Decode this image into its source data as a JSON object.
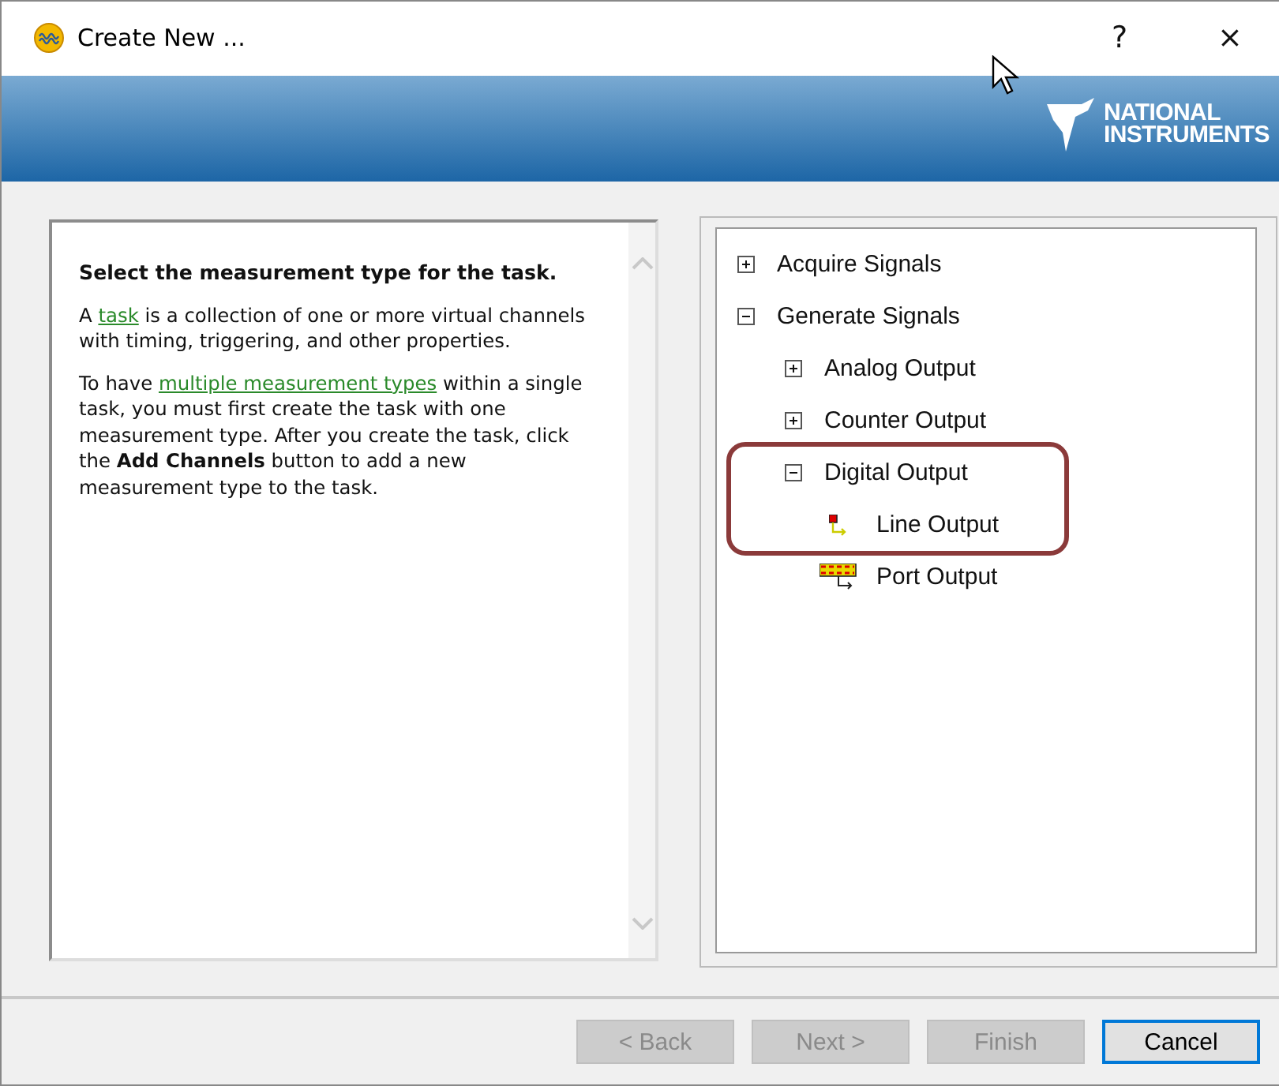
{
  "window": {
    "title": "Create New ...",
    "help": "?",
    "close": "×"
  },
  "banner": {
    "logo_lines": [
      "NATIONAL",
      "INSTRUMENTS"
    ]
  },
  "help_panel": {
    "heading": "Select the measurement type for the task.",
    "paragraphs": [
      {
        "parts": [
          {
            "text": "A ",
            "kind": "text"
          },
          {
            "text": "task",
            "kind": "link"
          },
          {
            "text": " is a collection of one or more virtual channels with timing, triggering, and other properties.",
            "kind": "text"
          }
        ]
      },
      {
        "parts": [
          {
            "text": "To have ",
            "kind": "text"
          },
          {
            "text": "multiple measurement types",
            "kind": "link"
          },
          {
            "text": " within a single task, you must first create the task with one measurement type. After you create the task, click the **Add Channels** button to add a new measurement type to the task.",
            "kind": "text"
          }
        ]
      }
    ]
  },
  "tree": [
    {
      "label": "Acquire Signals",
      "kind": "group",
      "expanded": false,
      "highlighted": false
    },
    {
      "label": "Generate Signals",
      "kind": "group",
      "expanded": true,
      "highlighted": false,
      "children": [
        {
          "label": "Analog Output",
          "kind": "group",
          "expanded": false,
          "highlighted": false
        },
        {
          "label": "Counter Output",
          "kind": "group",
          "expanded": false,
          "highlighted": false
        },
        {
          "label": "Digital Output",
          "kind": "group",
          "expanded": true,
          "highlighted": true,
          "children": [
            {
              "label": "Line Output",
              "kind": "line",
              "highlighted": true
            },
            {
              "label": "Port Output",
              "kind": "port",
              "highlighted": false
            }
          ]
        }
      ]
    }
  ],
  "buttons": [
    {
      "label": "< Back",
      "disabled": true,
      "default": false
    },
    {
      "label": "Next >",
      "disabled": true,
      "default": false
    },
    {
      "label": "Finish",
      "disabled": true,
      "default": false
    },
    {
      "label": "Cancel",
      "disabled": false,
      "default": true
    }
  ]
}
